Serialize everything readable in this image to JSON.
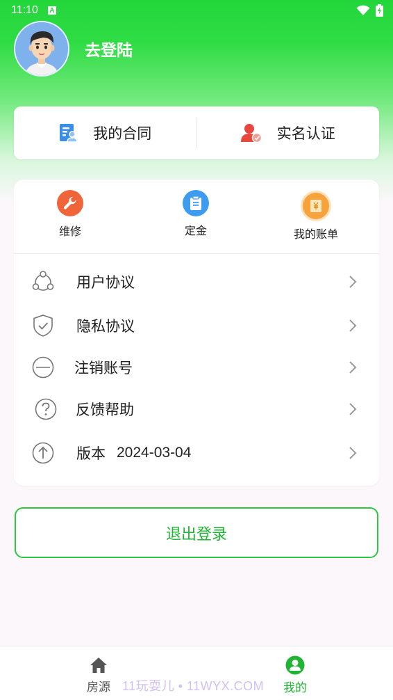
{
  "status_bar": {
    "time": "11:10",
    "notification_badge": "A"
  },
  "profile": {
    "login_text": "去登陆"
  },
  "top_card": {
    "contract_label": "我的合同",
    "realname_label": "实名认证"
  },
  "quick_actions": [
    {
      "label": "维修",
      "icon": "wrench-icon",
      "color": "#f0643a"
    },
    {
      "label": "定金",
      "icon": "clipboard-icon",
      "color": "#3d9cf0"
    },
    {
      "label": "我的账单",
      "icon": "yen-bill-icon",
      "color": "#f7a23a"
    }
  ],
  "menu": [
    {
      "label": "用户协议",
      "icon": "share-circle-icon"
    },
    {
      "label": "隐私协议",
      "icon": "shield-check-icon"
    },
    {
      "label": "注销账号",
      "icon": "minus-circle-icon"
    },
    {
      "label": "反馈帮助",
      "icon": "question-circle-icon"
    },
    {
      "label": "版本",
      "value": "2024-03-04",
      "icon": "arrow-up-circle-icon"
    }
  ],
  "logout_label": "退出登录",
  "bottom_nav": [
    {
      "label": "房源",
      "icon": "home-icon",
      "active": false
    },
    {
      "label": "我的",
      "icon": "user-circle-icon",
      "active": true
    }
  ],
  "watermark": "11玩耍儿 • 11WYX.COM",
  "colors": {
    "brand_green": "#22d63a",
    "accent_green": "#1fb434",
    "inactive": "#555555"
  }
}
